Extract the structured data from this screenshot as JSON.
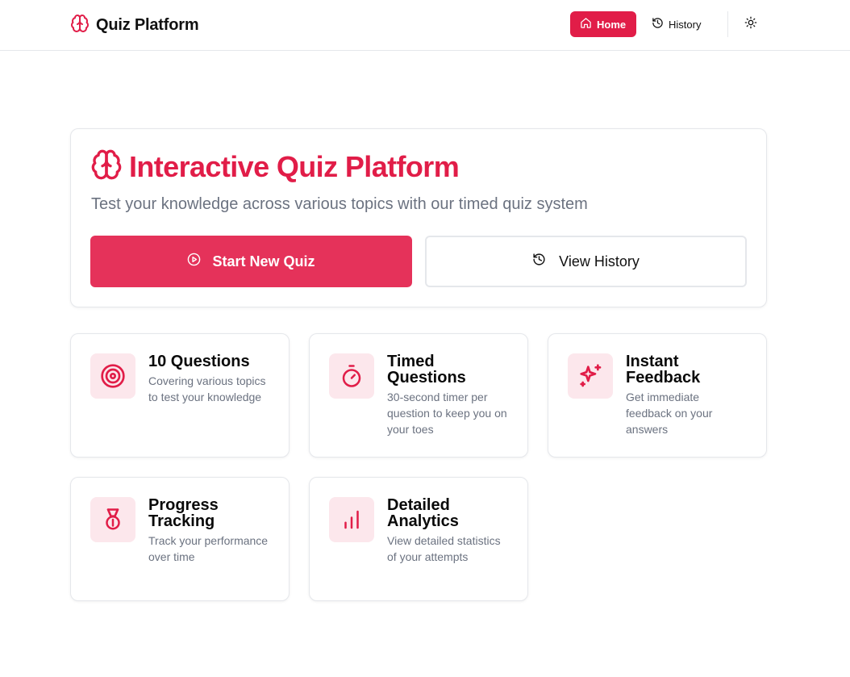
{
  "navbar": {
    "brand_icon": "brain-icon",
    "brand_title": "Quiz Platform",
    "home_label": "Home",
    "history_label": "History",
    "theme_icon": "sun-icon"
  },
  "colors": {
    "accent": "#e11d48",
    "accent_soft": "#fce7ec",
    "muted_text": "#6b7280",
    "border": "#e5e7eb"
  },
  "hero": {
    "icon": "brain-icon",
    "title": "Interactive Quiz Platform",
    "subtitle": "Test your knowledge across various topics with our timed quiz system",
    "start_label": "Start New Quiz",
    "history_label": "View History"
  },
  "features": [
    {
      "icon": "target-icon",
      "title": "10 Questions",
      "description": "Covering various topics to test your knowledge"
    },
    {
      "icon": "stopwatch-icon",
      "title": "Timed Questions",
      "description": "30-second timer per question to keep you on your toes"
    },
    {
      "icon": "sparkles-icon",
      "title": "Instant Feedback",
      "description": "Get immediate feedback on your answers"
    },
    {
      "icon": "medal-icon",
      "title": "Progress Tracking",
      "description": "Track your performance over time"
    },
    {
      "icon": "bar-chart-icon",
      "title": "Detailed Analytics",
      "description": "View detailed statistics of your attempts"
    }
  ]
}
